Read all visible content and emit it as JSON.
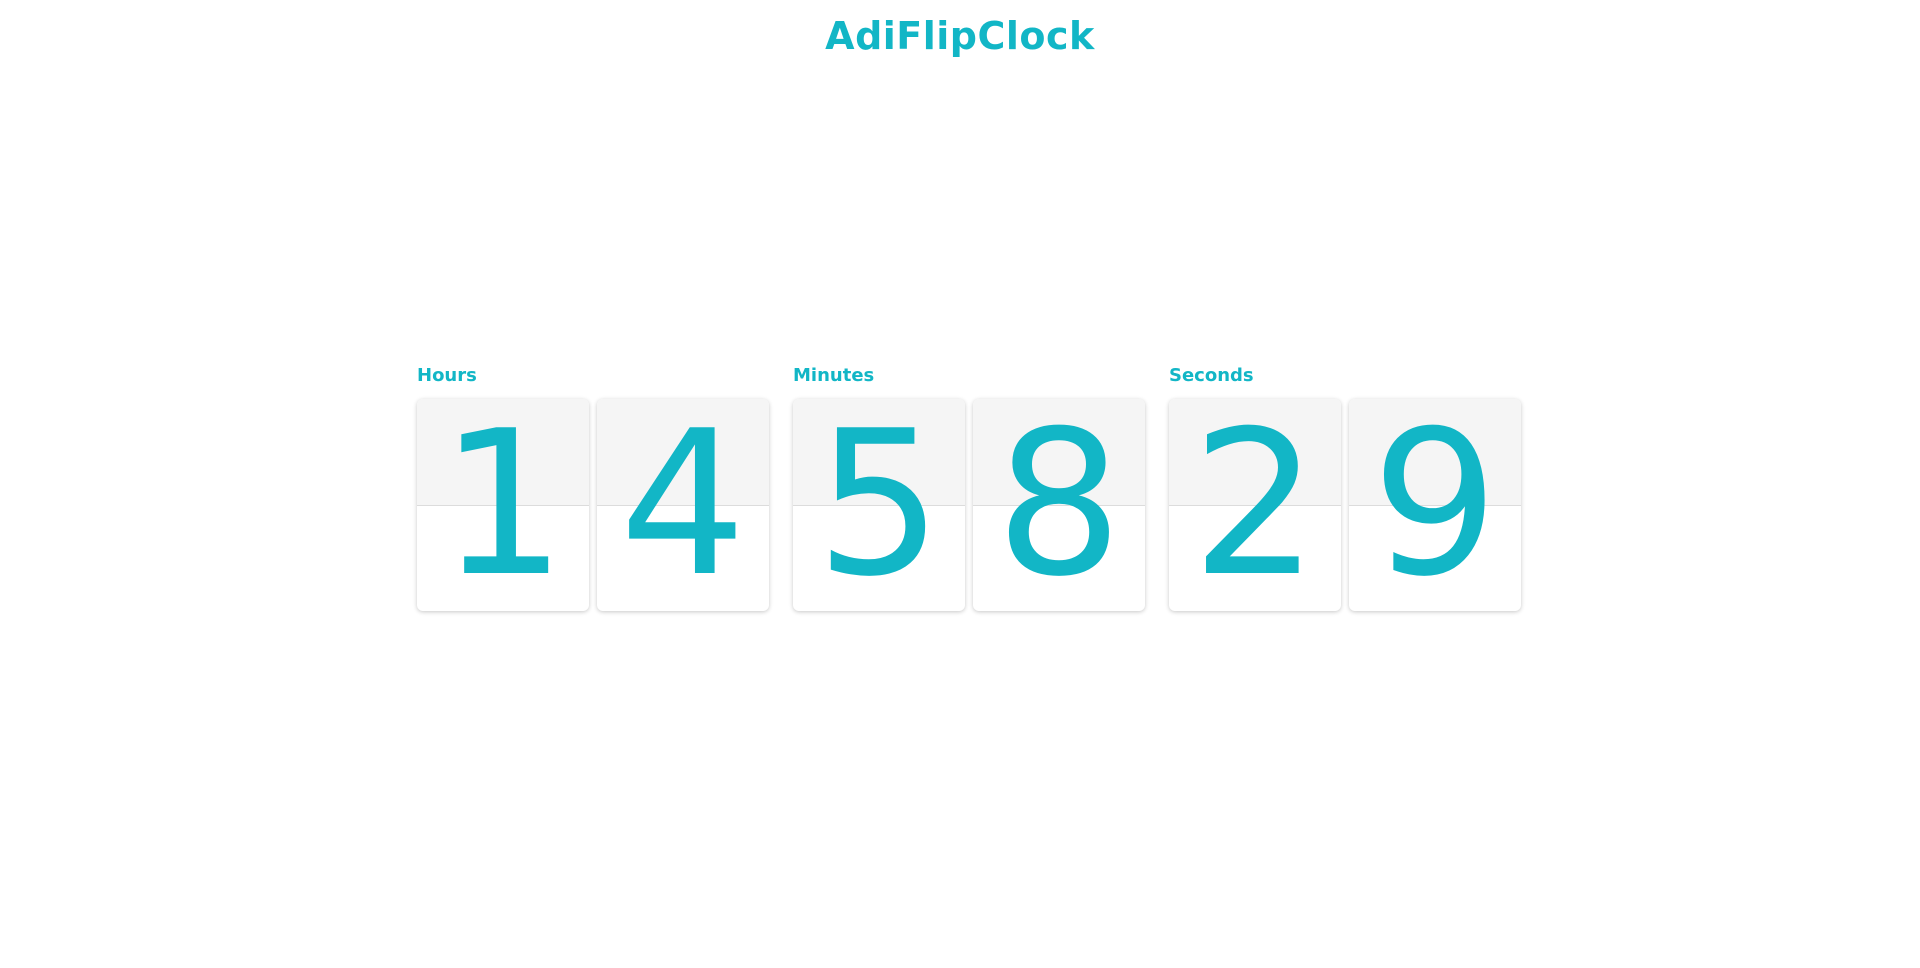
{
  "app": {
    "title": "AdiFlipClock"
  },
  "clock": {
    "groups": [
      {
        "label": "Hours",
        "digits": [
          "1",
          "4"
        ]
      },
      {
        "label": "Minutes",
        "digits": [
          "5",
          "8"
        ]
      },
      {
        "label": "Seconds",
        "digits": [
          "2",
          "9"
        ]
      }
    ]
  },
  "colors": {
    "accent": "#12b6c6",
    "card_top": "#f5f5f5",
    "card_bottom": "#ffffff",
    "background": "#ffffff"
  }
}
